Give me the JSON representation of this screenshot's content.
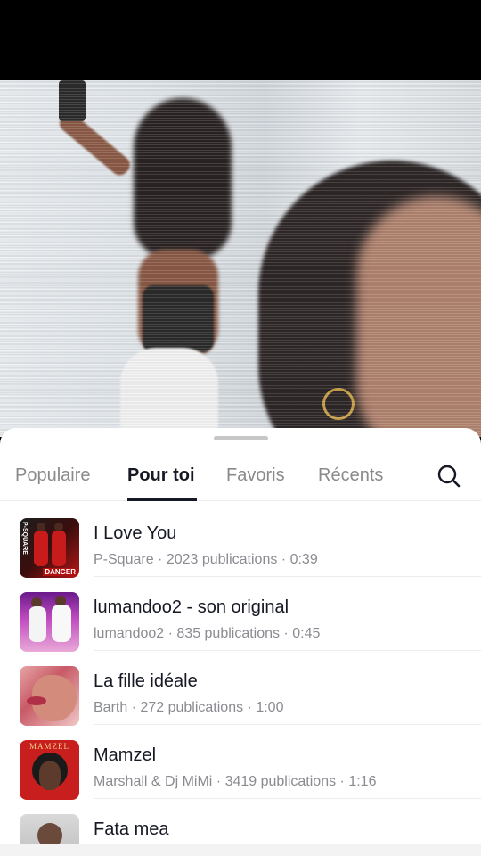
{
  "sheet": {
    "tabs": [
      {
        "label": "Populaire"
      },
      {
        "label": "Pour toi"
      },
      {
        "label": "Favoris"
      },
      {
        "label": "Récents"
      }
    ],
    "active_tab": "Pour toi",
    "search_icon": "search-icon"
  },
  "songs": [
    {
      "title": "I Love You",
      "meta": "P-Square · 2023 publications · 0:39",
      "cover_text_1": "P-SQUARE",
      "cover_text_2": "DANGER"
    },
    {
      "title": "lumandoo2 - son original",
      "meta": "lumandoo2 · 835 publications · 0:45"
    },
    {
      "title": "La fille idéale",
      "meta": "Barth · 272 publications · 1:00"
    },
    {
      "title": "Mamzel",
      "meta": "Marshall & Dj MiMi · 3419 publications · 1:16",
      "cover_text_1": "MAMZEL"
    },
    {
      "title": "Fata mea",
      "meta": ""
    }
  ],
  "colors": {
    "active_text": "#161823",
    "inactive_text": "#8a8a8a",
    "meta_text": "#8a8b91"
  }
}
